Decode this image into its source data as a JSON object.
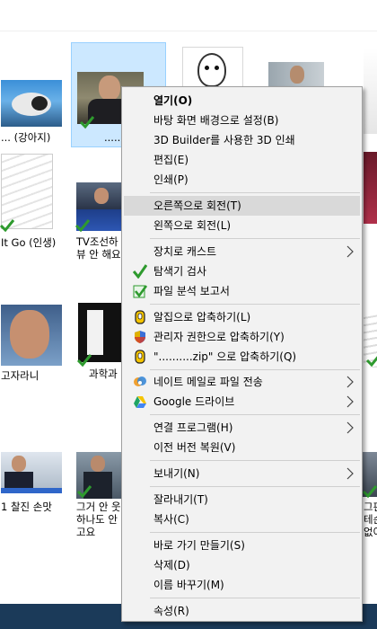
{
  "files": [
    {
      "label": "... (강아지)"
    },
    {
      "label": "......"
    },
    {
      "label": "It Go (인생)"
    },
    {
      "label_line1": "TV조선하",
      "label_line2": "뷰 안 해요"
    },
    {
      "label": "고자라니"
    },
    {
      "label": "과학과"
    },
    {
      "label": "1 찰진 손맛"
    },
    {
      "label_line1": "그거 안 웃",
      "label_line2": "하나도 안",
      "label_line3": "고요"
    },
    {
      "label_line1": "그판",
      "label_line2": "테슨",
      "label_line3": "없어"
    }
  ],
  "context_menu": {
    "items": [
      {
        "label": "열기(O)",
        "bold": true
      },
      {
        "label": "바탕 화면 배경으로 설정(B)"
      },
      {
        "label": "3D Builder를 사용한 3D 인쇄"
      },
      {
        "label": "편집(E)"
      },
      {
        "label": "인쇄(P)"
      },
      {
        "label": "오른쪽으로 회전(T)",
        "highlighted": true
      },
      {
        "label": "왼쪽으로 회전(L)"
      },
      {
        "label": "장치로 캐스트",
        "submenu": true
      },
      {
        "label": "탐색기 검사",
        "icon": "v3-check-icon"
      },
      {
        "label": "파일 분석 보고서",
        "icon": "v3-report-icon"
      },
      {
        "label": "알집으로 압축하기(L)",
        "icon": "alzip-icon"
      },
      {
        "label": "관리자 권한으로 압축하기(Y)",
        "icon": "admin-shield-icon"
      },
      {
        "label": "\"..........zip\" 으로 압축하기(Q)",
        "icon": "alzip-icon"
      },
      {
        "label": "네이트 메일로 파일 전송",
        "icon": "nate-mail-icon",
        "submenu": true
      },
      {
        "label": "Google 드라이브",
        "icon": "google-drive-icon",
        "submenu": true
      },
      {
        "label": "연결 프로그램(H)",
        "submenu": true
      },
      {
        "label": "이전 버전 복원(V)"
      },
      {
        "label": "보내기(N)",
        "submenu": true
      },
      {
        "label": "잘라내기(T)"
      },
      {
        "label": "복사(C)"
      },
      {
        "label": "바로 가기 만들기(S)"
      },
      {
        "label": "삭제(D)"
      },
      {
        "label": "이름 바꾸기(M)"
      },
      {
        "label": "속성(R)"
      }
    ]
  },
  "colors": {
    "selection_bg": "#cce8ff",
    "menu_bg": "#f2f2f2",
    "menu_hover": "#d9d9d9",
    "taskbar": "#1b3a59",
    "check_green": "#2e9a2e"
  }
}
